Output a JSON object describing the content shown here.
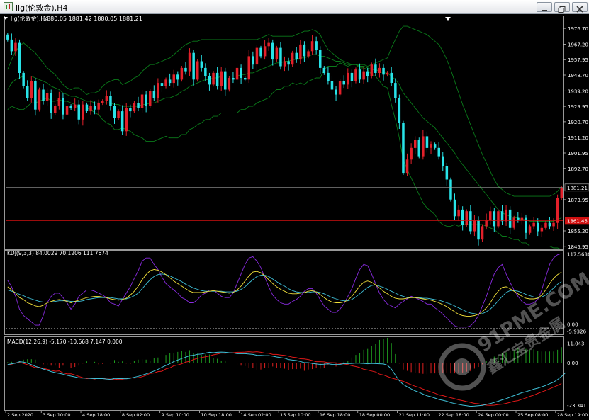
{
  "window": {
    "title": "llg(伦敦金),H4"
  },
  "chart_data": {
    "type": "candlestick",
    "symbol_header": "llg(伦敦金),H4",
    "ohlc_header": "1880.05 1881.42 1880.05 1881.21",
    "price_axis": {
      "ticks": [
        "1976.70",
        "1967.20",
        "1957.95",
        "1948.70",
        "1939.20",
        "1929.95",
        "1920.70",
        "1911.20",
        "1901.95",
        "1892.70",
        "1873.95",
        "1855.20",
        "1845.95"
      ],
      "tick_values": [
        1976.7,
        1967.2,
        1957.95,
        1948.7,
        1939.2,
        1929.95,
        1920.7,
        1911.2,
        1901.95,
        1892.7,
        1873.95,
        1855.2,
        1845.95
      ],
      "ylim": [
        1845.0,
        1981.0
      ],
      "current_price": "1881.21",
      "current_value": 1881.21,
      "level_label": "1861.45",
      "level_value": 1861.45
    },
    "x_labels": [
      "2 Sep 2020",
      "3 Sep 10:00",
      "4 Sep 18:00",
      "8 Sep 02:00",
      "9 Sep 10:00",
      "10 Sep 18:00",
      "14 Sep 02:00",
      "15 Sep 10:00",
      "16 Sep 18:00",
      "18 Sep 00:00",
      "21 Sep 11:00",
      "22 Sep 18:00",
      "24 Sep 00:00",
      "25 Sep 08:00",
      "28 Sep 19:00"
    ],
    "x_label_idx": [
      0,
      9,
      19,
      29,
      39,
      49,
      59,
      69,
      79,
      89,
      99,
      109,
      119,
      129,
      139
    ],
    "close": [
      1970,
      1963,
      1968,
      1950,
      1942,
      1935,
      1945,
      1928,
      1940,
      1933,
      1938,
      1926,
      1930,
      1935,
      1925,
      1930,
      1929,
      1931,
      1922,
      1931,
      1927,
      1930,
      1928,
      1932,
      1933,
      1936,
      1930,
      1923,
      1927,
      1915,
      1929,
      1927,
      1932,
      1929,
      1937,
      1930,
      1939,
      1935,
      1944,
      1942,
      1946,
      1944,
      1949,
      1946,
      1953,
      1951,
      1962,
      1946,
      1957,
      1953,
      1948,
      1943,
      1950,
      1942,
      1951,
      1940,
      1947,
      1946,
      1953,
      1947,
      1946,
      1960,
      1955,
      1965,
      1960,
      1966,
      1968,
      1958,
      1965,
      1954,
      1957,
      1955,
      1962,
      1958,
      1967,
      1960,
      1963,
      1969,
      1964,
      1953,
      1950,
      1945,
      1940,
      1937,
      1945,
      1943,
      1950,
      1945,
      1952,
      1946,
      1951,
      1948,
      1955,
      1950,
      1953,
      1949,
      1950,
      1944,
      1935,
      1920,
      1890,
      1898,
      1905,
      1910,
      1900,
      1912,
      1905,
      1907,
      1905,
      1900,
      1894,
      1886,
      1874,
      1864,
      1868,
      1859,
      1867,
      1855,
      1862,
      1850,
      1858,
      1862,
      1867,
      1858,
      1867,
      1861,
      1868,
      1857,
      1863,
      1862,
      1863,
      1854,
      1858,
      1860,
      1855,
      1857,
      1860,
      1858,
      1860,
      1875,
      1881.21
    ],
    "bollinger": {
      "upper": [
        1952,
        1958,
        1963,
        1966,
        1968,
        1966,
        1964,
        1962,
        1959,
        1956,
        1953,
        1951,
        1949,
        1946,
        1943,
        1941,
        1940,
        1941,
        1941,
        1939,
        1937,
        1938,
        1938,
        1939,
        1942,
        1944,
        1945,
        1946,
        1946,
        1943,
        1944,
        1945,
        1947,
        1948,
        1951,
        1953,
        1955,
        1955,
        1956,
        1957,
        1958,
        1959,
        1961,
        1963,
        1965,
        1967,
        1968,
        1969,
        1969,
        1970,
        1970,
        1970,
        1970,
        1970,
        1970,
        1970,
        1970,
        1970,
        1970,
        1970,
        1970,
        1970,
        1970,
        1970,
        1971,
        1972,
        1973,
        1972,
        1972,
        1972,
        1972,
        1972,
        1972,
        1973,
        1974,
        1975,
        1975,
        1976,
        1975,
        1973,
        1968,
        1964,
        1962,
        1960,
        1958,
        1957,
        1956,
        1955,
        1955,
        1955,
        1955,
        1954,
        1955,
        1956,
        1957,
        1958,
        1959,
        1965,
        1970,
        1975,
        1978,
        1978,
        1977,
        1976,
        1975,
        1974,
        1973,
        1971,
        1969,
        1967,
        1963,
        1958,
        1952,
        1945,
        1938,
        1931,
        1925,
        1919,
        1913,
        1907,
        1901,
        1896,
        1891,
        1886,
        1882,
        1880,
        1878,
        1877,
        1876,
        1876,
        1876,
        1876,
        1876,
        1876,
        1876,
        1876,
        1876,
        1876,
        1877,
        1879,
        1882
      ],
      "middle": [
        1940,
        1944,
        1946,
        1947,
        1948,
        1948,
        1948,
        1947,
        1946,
        1945,
        1944,
        1942,
        1941,
        1940,
        1938,
        1937,
        1936,
        1936,
        1935,
        1934,
        1933,
        1933,
        1932,
        1932,
        1932,
        1932,
        1932,
        1931,
        1931,
        1930,
        1930,
        1930,
        1930,
        1930,
        1931,
        1931,
        1932,
        1932,
        1933,
        1934,
        1935,
        1935,
        1936,
        1937,
        1939,
        1940,
        1942,
        1943,
        1944,
        1945,
        1946,
        1946,
        1947,
        1947,
        1948,
        1948,
        1948,
        1948,
        1948,
        1949,
        1949,
        1950,
        1950,
        1951,
        1952,
        1953,
        1954,
        1955,
        1956,
        1956,
        1957,
        1957,
        1958,
        1958,
        1959,
        1959,
        1960,
        1961,
        1961,
        1960,
        1960,
        1959,
        1958,
        1957,
        1957,
        1956,
        1955,
        1955,
        1955,
        1954,
        1954,
        1953,
        1952,
        1952,
        1951,
        1950,
        1950,
        1948,
        1946,
        1943,
        1938,
        1935,
        1932,
        1929,
        1926,
        1923,
        1921,
        1919,
        1917,
        1914,
        1911,
        1908,
        1905,
        1902,
        1898,
        1895,
        1892,
        1889,
        1886,
        1883,
        1880,
        1877,
        1874,
        1871,
        1868,
        1866,
        1865,
        1864,
        1863,
        1863,
        1862,
        1862,
        1861,
        1861,
        1861,
        1861,
        1861,
        1861,
        1861,
        1862,
        1863
      ],
      "lower": [
        1928,
        1930,
        1929,
        1928,
        1928,
        1930,
        1932,
        1932,
        1933,
        1934,
        1935,
        1933,
        1933,
        1934,
        1933,
        1933,
        1932,
        1931,
        1929,
        1929,
        1929,
        1928,
        1926,
        1925,
        1922,
        1920,
        1919,
        1916,
        1916,
        1917,
        1916,
        1915,
        1913,
        1912,
        1911,
        1909,
        1909,
        1909,
        1910,
        1911,
        1912,
        1911,
        1911,
        1911,
        1913,
        1913,
        1916,
        1917,
        1919,
        1920,
        1922,
        1922,
        1924,
        1924,
        1926,
        1926,
        1926,
        1926,
        1926,
        1928,
        1928,
        1930,
        1930,
        1932,
        1933,
        1934,
        1935,
        1938,
        1940,
        1940,
        1942,
        1942,
        1944,
        1943,
        1944,
        1943,
        1945,
        1946,
        1947,
        1947,
        1952,
        1954,
        1954,
        1954,
        1956,
        1955,
        1954,
        1955,
        1955,
        1953,
        1953,
        1952,
        1949,
        1948,
        1945,
        1942,
        1941,
        1931,
        1922,
        1911,
        1898,
        1892,
        1887,
        1882,
        1877,
        1872,
        1869,
        1867,
        1865,
        1861,
        1859,
        1858,
        1858,
        1859,
        1858,
        1859,
        1859,
        1859,
        1859,
        1859,
        1859,
        1858,
        1857,
        1856,
        1854,
        1852,
        1852,
        1851,
        1850,
        1850,
        1848,
        1848,
        1846,
        1846,
        1846,
        1846,
        1846,
        1846,
        1845,
        1845,
        1844
      ]
    },
    "kdj": {
      "label": "KDJ(9,3,3) 84.0029 70.1206 111.7674",
      "ticks": [
        "117.5636",
        "0.00",
        "-5.9326"
      ],
      "tick_values": [
        117.5636,
        0.0,
        -5.9326
      ],
      "ylim": [
        -6,
        118
      ],
      "k": [
        65,
        60,
        55,
        48,
        45,
        40,
        38,
        35,
        34,
        36,
        40,
        42,
        44,
        45,
        44,
        42,
        40,
        42,
        44,
        46,
        48,
        49,
        50,
        50,
        49,
        48,
        46,
        45,
        44,
        45,
        47,
        52,
        58,
        66,
        76,
        84,
        90,
        92,
        91,
        88,
        84,
        79,
        74,
        70,
        66,
        62,
        58,
        56,
        56,
        56,
        57,
        58,
        59,
        58,
        57,
        56,
        55,
        56,
        60,
        66,
        74,
        82,
        88,
        89,
        87,
        82,
        76,
        70,
        65,
        61,
        58,
        55,
        54,
        54,
        55,
        56,
        58,
        59,
        57,
        53,
        48,
        44,
        41,
        40,
        40,
        41,
        44,
        50,
        58,
        66,
        72,
        74,
        72,
        68,
        63,
        58,
        54,
        50,
        47,
        46,
        46,
        47,
        48,
        48,
        47,
        46,
        45,
        44,
        42,
        40,
        37,
        34,
        30,
        26,
        22,
        20,
        19,
        19,
        20,
        22,
        26,
        32,
        40,
        50,
        58,
        64,
        65,
        62,
        58,
        54,
        50,
        47,
        46,
        46,
        47,
        52,
        60,
        70,
        78,
        84,
        88
      ],
      "d": [
        60,
        58,
        56,
        53,
        51,
        48,
        46,
        44,
        42,
        41,
        41,
        41,
        42,
        43,
        43,
        43,
        42,
        42,
        42,
        43,
        45,
        46,
        47,
        48,
        48,
        48,
        48,
        47,
        46,
        46,
        46,
        48,
        51,
        55,
        62,
        69,
        76,
        81,
        84,
        85,
        84,
        82,
        79,
        76,
        73,
        69,
        66,
        63,
        61,
        59,
        58,
        58,
        58,
        58,
        58,
        57,
        57,
        57,
        58,
        61,
        65,
        71,
        76,
        81,
        83,
        83,
        81,
        77,
        73,
        69,
        66,
        62,
        59,
        57,
        56,
        56,
        56,
        57,
        57,
        56,
        54,
        51,
        48,
        46,
        44,
        43,
        43,
        45,
        49,
        54,
        59,
        64,
        67,
        68,
        66,
        64,
        61,
        58,
        55,
        52,
        50,
        48,
        48,
        48,
        48,
        47,
        47,
        46,
        45,
        44,
        42,
        40,
        38,
        35,
        32,
        29,
        26,
        24,
        23,
        22,
        23,
        26,
        30,
        36,
        43,
        50,
        56,
        59,
        59,
        58,
        56,
        53,
        51,
        49,
        48,
        49,
        52,
        57,
        63,
        69,
        73
      ],
      "j": [
        75,
        65,
        50,
        30,
        20,
        15,
        10,
        5,
        5,
        20,
        40,
        50,
        55,
        55,
        48,
        40,
        30,
        38,
        50,
        55,
        60,
        60,
        58,
        55,
        52,
        48,
        40,
        38,
        35,
        45,
        55,
        65,
        78,
        90,
        105,
        110,
        110,
        100,
        92,
        80,
        70,
        65,
        60,
        55,
        48,
        45,
        40,
        40,
        45,
        52,
        55,
        60,
        60,
        55,
        50,
        48,
        48,
        55,
        70,
        85,
        100,
        110,
        112,
        105,
        95,
        80,
        65,
        52,
        45,
        40,
        38,
        38,
        42,
        45,
        50,
        58,
        62,
        62,
        55,
        45,
        35,
        30,
        25,
        25,
        30,
        38,
        50,
        62,
        78,
        92,
        100,
        98,
        85,
        70,
        55,
        45,
        38,
        35,
        32,
        38,
        42,
        46,
        50,
        48,
        45,
        42,
        38,
        38,
        32,
        28,
        22,
        16,
        10,
        4,
        2,
        2,
        2,
        4,
        10,
        20,
        35,
        50,
        68,
        85,
        95,
        100,
        85,
        72,
        60,
        50,
        42,
        38,
        38,
        40,
        45,
        60,
        80,
        100,
        110,
        115,
        117
      ]
    },
    "macd": {
      "label": "MACD(12,26,9) -5.170 -10.668 7.147 0.000",
      "ticks": [
        "11.043",
        "0.00",
        "-23.341"
      ],
      "tick_values": [
        11.043,
        0.0,
        -23.341
      ],
      "ylim": [
        -24,
        12
      ],
      "signal": [
        -1.1,
        -0.8,
        -0.1,
        0.1,
        -0.4,
        -1.0,
        -1.8,
        -2.6,
        -2.4,
        -2.9,
        -3.4,
        -3.9,
        -4.4,
        -4.2,
        -5.2,
        -5.8,
        -5.7,
        -6.3,
        -7.1,
        -7.7,
        -8.2,
        -8.0,
        -8.4,
        -7.8,
        -7.9,
        -8.4,
        -8.4,
        -8.7,
        -8.4,
        -8.5,
        -8.1,
        -7.7,
        -7.9,
        -7.7,
        -7.2,
        -6.5,
        -5.5,
        -5.3,
        -4.6,
        -4.4,
        -3.2,
        -2.7,
        -1.6,
        -1.2,
        -0.6,
        0.3,
        0.7,
        1.6,
        2.2,
        2.6,
        3.0,
        3.4,
        4.0,
        4.4,
        4.9,
        4.8,
        5.1,
        5.1,
        5.3,
        5.3,
        5.4,
        5.6,
        5.4,
        5.6,
        5.3,
        4.9,
        4.8,
        4.2,
        4.2,
        3.9,
        3.7,
        3.3,
        2.8,
        2.6,
        2.0,
        1.9,
        1.6,
        1.1,
        0.5,
        0.5,
        0.4,
        0.0,
        0.0,
        -0.1,
        -0.5,
        -0.7,
        -1.0,
        -1.6,
        -2.0,
        -2.5,
        -3.4,
        -3.8,
        -4.3,
        -4.8,
        -5.9,
        -6.3,
        -7.1,
        -7.9,
        -8.4,
        -9.1,
        -9.6,
        -10.5,
        -11.3,
        -12.1,
        -12.7,
        -13.6,
        -14.3,
        -15.0,
        -15.7,
        -16.6,
        -16.9,
        -17.5,
        -18.0,
        -18.5,
        -19.1,
        -19.5,
        -20.0,
        -20.4,
        -20.9,
        -21.1,
        -21.5,
        -21.8,
        -21.9,
        -21.8,
        -21.5,
        -21.3,
        -20.9,
        -20.4,
        -19.8,
        -19.5,
        -18.8,
        -18.1,
        -17.3,
        -16.7,
        -15.8,
        -15.0,
        -14.3,
        -13.4,
        -12.6,
        -11.7,
        -10.7
      ],
      "macd": [
        -1.0,
        -0.6,
        -0.3,
        0.5,
        0.3,
        -0.2,
        -1.0,
        -1.9,
        -2.5,
        -3.3,
        -3.9,
        -4.6,
        -5.1,
        -5.5,
        -5.9,
        -6.5,
        -6.9,
        -7.3,
        -7.8,
        -7.9,
        -7.9,
        -8.1,
        -8.2,
        -8.2,
        -8.2,
        -8.4,
        -8.6,
        -8.1,
        -8.2,
        -8.2,
        -8.3,
        -8.0,
        -7.5,
        -7.0,
        -6.4,
        -5.8,
        -5.1,
        -4.3,
        -3.4,
        -2.4,
        -1.4,
        -0.5,
        0.6,
        1.3,
        2.1,
        2.8,
        3.6,
        3.8,
        4.3,
        4.4,
        4.9,
        5.3,
        5.1,
        5.3,
        5.4,
        5.3,
        5.1,
        5.0,
        4.6,
        4.6,
        4.6,
        4.4,
        4.2,
        3.8,
        3.7,
        3.6,
        3.6,
        3.3,
        2.9,
        2.6,
        2.3,
        1.6,
        1.3,
        1.1,
        0.6,
        0.0,
        0.0,
        -0.4,
        -0.7,
        -0.9,
        -0.8,
        -0.6,
        -0.9,
        -1.0,
        -0.9,
        -0.5,
        -0.5,
        -0.4,
        -0.2,
        -0.3,
        -0.4,
        -0.6,
        -0.4,
        -0.5,
        -0.6,
        -0.7,
        -1.3,
        -3.3,
        -6.4,
        -9.3,
        -11.2,
        -12.4,
        -13.5,
        -14.5,
        -15.2,
        -16.2,
        -17.0,
        -17.5,
        -18.2,
        -18.9,
        -19.3,
        -19.8,
        -20.5,
        -21.0,
        -21.4,
        -21.8,
        -22.1,
        -22.4,
        -22.3,
        -22.1,
        -21.9,
        -21.4,
        -21.0,
        -20.4,
        -19.8,
        -19.1,
        -18.5,
        -17.7,
        -16.9,
        -16.2,
        -15.4,
        -14.9,
        -14.3,
        -13.6,
        -13.1,
        -12.4,
        -11.7,
        -10.8,
        -10.0,
        -8.7,
        -7.1,
        -5.2
      ]
    }
  }
}
